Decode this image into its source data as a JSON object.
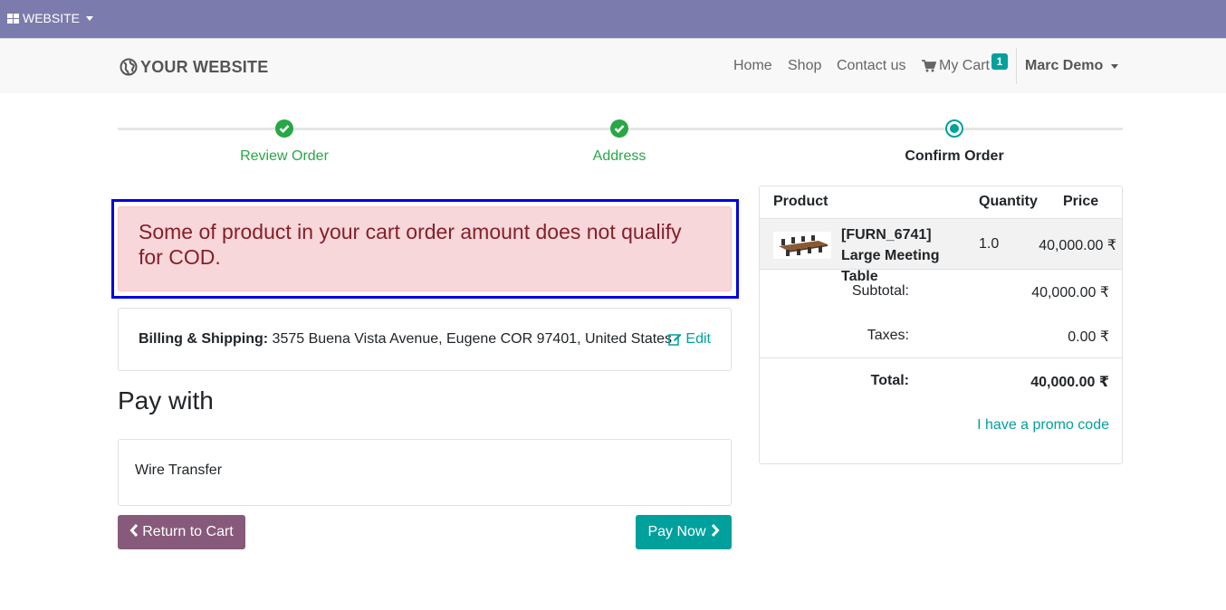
{
  "adminbar": {
    "website_menu": "WEBSITE"
  },
  "header": {
    "logo_text": "YOUR WEBSITE",
    "nav": {
      "home": "Home",
      "shop": "Shop",
      "contact": "Contact us",
      "cart": "My Cart",
      "cart_count": "1"
    },
    "user": "Marc Demo"
  },
  "wizard": {
    "steps": [
      {
        "label": "Review Order",
        "state": "done"
      },
      {
        "label": "Address",
        "state": "done"
      },
      {
        "label": "Confirm Order",
        "state": "current"
      }
    ]
  },
  "alert": {
    "message": "Some of product in your cart order amount does not qualify for COD."
  },
  "billing": {
    "label": "Billing & Shipping:",
    "address": "3575 Buena Vista Avenue, Eugene COR 97401, United States",
    "edit": "Edit"
  },
  "payment": {
    "heading": "Pay with",
    "options": [
      "Wire Transfer"
    ],
    "return_button": "Return to Cart",
    "pay_button": "Pay Now"
  },
  "summary": {
    "headers": {
      "product": "Product",
      "quantity": "Quantity",
      "price": "Price"
    },
    "line": {
      "name": "[FURN_6741] Large Meeting Table",
      "quantity": "1.0",
      "price": "40,000.00 ₹"
    },
    "subtotal_label": "Subtotal:",
    "subtotal": "40,000.00 ₹",
    "taxes_label": "Taxes:",
    "taxes": "0.00 ₹",
    "total_label": "Total:",
    "total": "40,000.00 ₹",
    "promo": "I have a promo code"
  },
  "colors": {
    "admin_bar": "#7c7bad",
    "primary": "#00a09d",
    "secondary": "#875a7b",
    "success": "#28a745",
    "alert_bg": "#f8d7da",
    "alert_text": "#842029"
  }
}
